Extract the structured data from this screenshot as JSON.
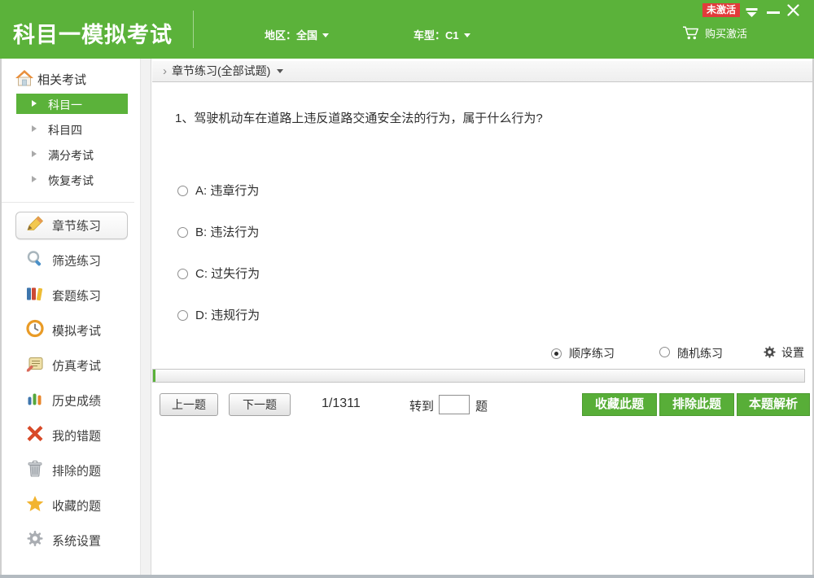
{
  "header": {
    "title": "科目一模拟考试",
    "region": "地区：全国",
    "vehicle": "车型：C1",
    "buy": "购买激活",
    "activation_badge": "未激活"
  },
  "sidebar": {
    "section_title": "相关考试",
    "exams": [
      {
        "label": "科目一",
        "active": true
      },
      {
        "label": "科目四",
        "active": false
      },
      {
        "label": "满分考试",
        "active": false
      },
      {
        "label": "恢复考试",
        "active": false
      }
    ],
    "menu": [
      {
        "label": "章节练习",
        "icon": "pencil-icon",
        "active": true
      },
      {
        "label": "筛选练习",
        "icon": "search-icon",
        "active": false
      },
      {
        "label": "套题练习",
        "icon": "books-icon",
        "active": false
      },
      {
        "label": "模拟考试",
        "icon": "clock-icon",
        "active": false
      },
      {
        "label": "仿真考试",
        "icon": "notepad-icon",
        "active": false
      },
      {
        "label": "历史成绩",
        "icon": "bar-chart-icon",
        "active": false
      },
      {
        "label": "我的错题",
        "icon": "red-x-icon",
        "active": false
      },
      {
        "label": "排除的题",
        "icon": "trash-icon",
        "active": false
      },
      {
        "label": "收藏的题",
        "icon": "star-icon",
        "active": false
      },
      {
        "label": "系统设置",
        "icon": "gear-icon",
        "active": false
      }
    ]
  },
  "main": {
    "breadcrumb": "章节练习(全部试题)",
    "question": "1、驾驶机动车在道路上违反道路交通安全法的行为，属于什么行为?",
    "options": [
      {
        "label": "A: 违章行为",
        "selected": false
      },
      {
        "label": "B: 违法行为",
        "selected": false
      },
      {
        "label": "C: 过失行为",
        "selected": false
      },
      {
        "label": "D: 违规行为",
        "selected": false
      }
    ],
    "mode": {
      "sequential": "顺序练习",
      "random": "随机练习",
      "settings": "设置",
      "selected": "顺序练习"
    },
    "pager": {
      "prev": "上一题",
      "next": "下一题",
      "progress": "1/1311",
      "goto_prefix": "转到",
      "goto_suffix": "题",
      "goto_value": ""
    },
    "actions": {
      "favorite": "收藏此题",
      "exclude": "排除此题",
      "analysis": "本题解析"
    }
  },
  "colors": {
    "brand_green": "#5bb23a",
    "badge_red": "#e23b3b"
  }
}
